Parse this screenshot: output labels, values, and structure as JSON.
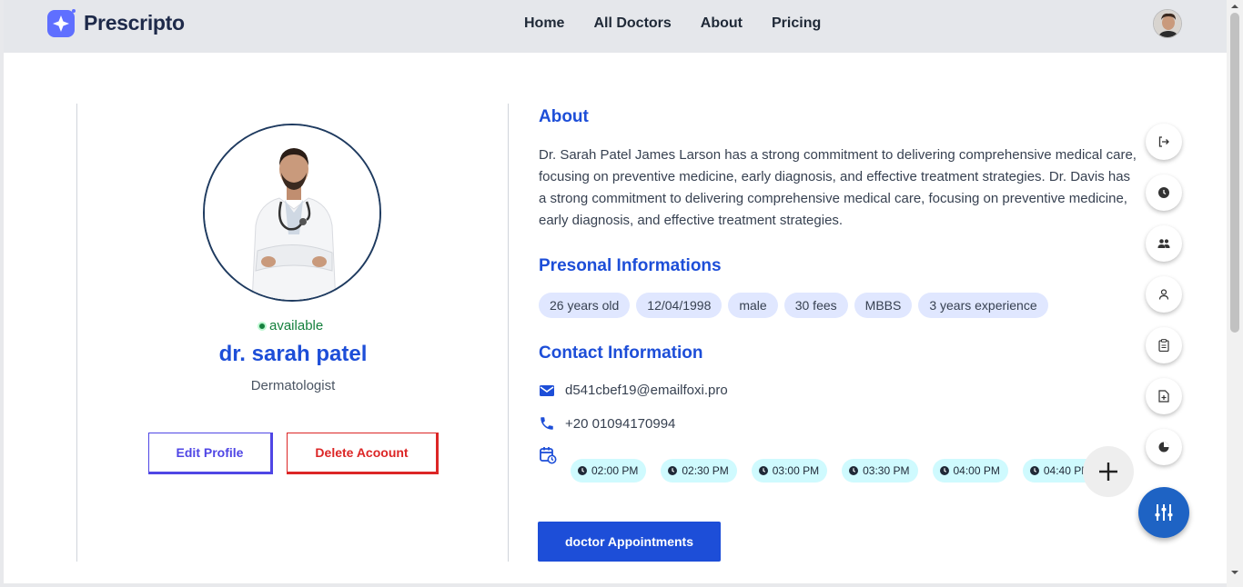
{
  "brand": {
    "name": "Prescripto"
  },
  "nav": {
    "links": [
      {
        "label": "Home"
      },
      {
        "label": "All Doctors"
      },
      {
        "label": "About"
      },
      {
        "label": "Pricing"
      }
    ]
  },
  "profile": {
    "status": "available",
    "name": "dr. sarah patel",
    "specialty": "Dermatologist",
    "edit_label": "Edit Profile",
    "delete_label": "Delete Acoount"
  },
  "about": {
    "title": "About",
    "text": "Dr. Sarah Patel James Larson has a strong commitment to delivering comprehensive medical care, focusing on preventive medicine, early diagnosis, and effective treatment strategies. Dr. Davis has a strong commitment to delivering comprehensive medical care, focusing on preventive medicine, early diagnosis, and effective treatment strategies."
  },
  "personal": {
    "title": "Presonal Informations",
    "tags": [
      "26 years old",
      "12/04/1998",
      "male",
      "30 fees",
      "MBBS",
      "3 years experience"
    ]
  },
  "contact": {
    "title": "Contact Information",
    "email": "d541cbef19@emailfoxi.pro",
    "phone": "+20 01094170994",
    "slots": [
      "02:00 PM",
      "02:30 PM",
      "03:00 PM",
      "03:30 PM",
      "04:00 PM",
      "04:40 PM"
    ]
  },
  "appointments_label": "doctor Appointments",
  "side_menu": [
    "logout-icon",
    "clock-icon",
    "users-icon",
    "user-icon",
    "clipboard-icon",
    "file-plus-icon",
    "pie-chart-icon"
  ],
  "colors": {
    "accent": "#1d4ed8",
    "danger": "#dc2626",
    "edit": "#4f46e5",
    "available": "#15803d",
    "slot_bg": "#cffafe",
    "tag_bg": "#e0e7ff"
  }
}
